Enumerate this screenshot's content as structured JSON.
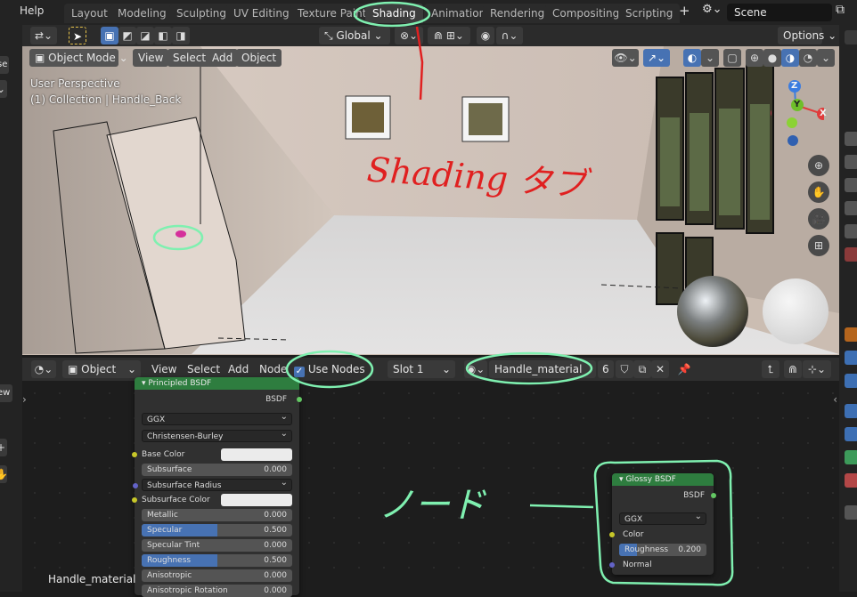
{
  "topbar": {
    "menu_help": "Help",
    "workspaces": [
      "Layout",
      "Modeling",
      "Sculpting",
      "UV Editing",
      "Texture Paint",
      "Shading",
      "Animation",
      "Rendering",
      "Compositing",
      "Scripting"
    ],
    "active_workspace": "Shading",
    "scene": "Scene"
  },
  "viewport_header": {
    "mode": "Object Mode",
    "menus": [
      "View",
      "Select",
      "Add",
      "Object"
    ],
    "transform_orientation": "Global",
    "options": "Options"
  },
  "viewport": {
    "perspective_label": "User Perspective",
    "collection_label": "(1) Collection | Handle_Back",
    "left_strip_partial_1": "se",
    "gizmo_axes": [
      "Z",
      "Y",
      "X"
    ]
  },
  "node_header": {
    "editor_type": "Object",
    "menus": [
      "View",
      "Select",
      "Add",
      "Node"
    ],
    "use_nodes_label": "Use Nodes",
    "use_nodes_checked": true,
    "slot": "Slot 1",
    "material_name": "Handle_material",
    "user_count": "6",
    "left_partial_label": "ew"
  },
  "principled_node": {
    "title": "Principled BSDF",
    "output": "BSDF",
    "distribution": "GGX",
    "subsurface_method": "Christensen-Burley",
    "rows": [
      {
        "label": "Base Color",
        "kind": "color",
        "socket": "yellow"
      },
      {
        "label": "Subsurface",
        "kind": "value",
        "value": "0.000",
        "fill": 0,
        "socket": "gray"
      },
      {
        "label": "Subsurface Radius",
        "kind": "dropdown",
        "socket": "purple"
      },
      {
        "label": "Subsurface Color",
        "kind": "color",
        "socket": "yellow"
      },
      {
        "label": "Metallic",
        "kind": "value",
        "value": "0.000",
        "fill": 0,
        "socket": "gray"
      },
      {
        "label": "Specular",
        "kind": "value",
        "value": "0.500",
        "fill": 0.5,
        "socket": "gray"
      },
      {
        "label": "Specular Tint",
        "kind": "value",
        "value": "0.000",
        "fill": 0,
        "socket": "gray"
      },
      {
        "label": "Roughness",
        "kind": "value",
        "value": "0.500",
        "fill": 0.5,
        "socket": "gray"
      },
      {
        "label": "Anisotropic",
        "kind": "value",
        "value": "0.000",
        "fill": 0,
        "socket": "gray"
      },
      {
        "label": "Anisotropic Rotation",
        "kind": "value",
        "value": "0.000",
        "fill": 0,
        "socket": "gray"
      }
    ]
  },
  "glossy_node": {
    "title": "Glossy BSDF",
    "output": "BSDF",
    "distribution": "GGX",
    "color_label": "Color",
    "roughness_label": "Roughness",
    "roughness_value": "0.200",
    "roughness_fill": 0.2,
    "normal_label": "Normal"
  },
  "canvas_label": "Handle_material",
  "annotations": {
    "shading_note": "Shading タブ",
    "node_note": "ノード"
  },
  "colors": {
    "accent_blue": "#4772b3",
    "node_header_green": "#2e7d3f",
    "annotation_red": "#e02020",
    "annotation_green": "#7ff0b0"
  }
}
